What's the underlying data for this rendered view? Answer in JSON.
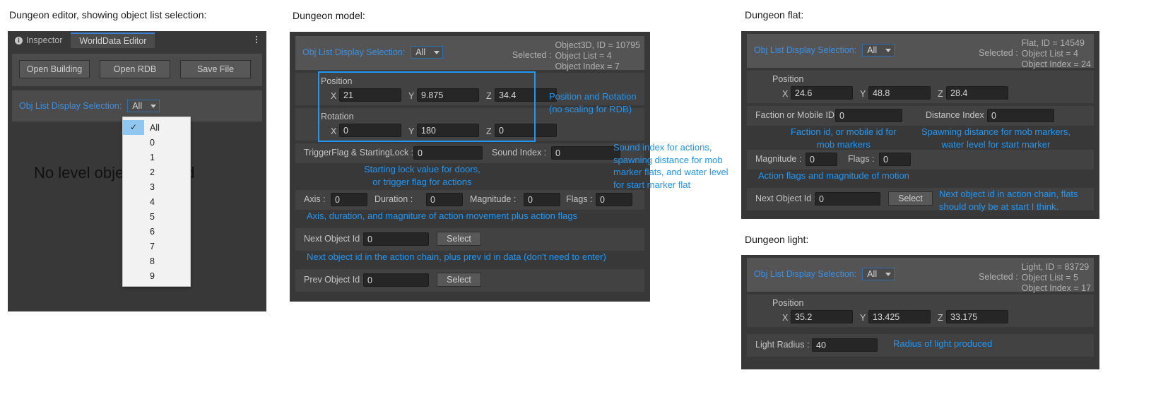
{
  "captions": {
    "editor": "Dungeon editor, showing object list selection:",
    "model": "Dungeon model:",
    "flat": "Dungeon flat:",
    "light": "Dungeon light:"
  },
  "editor_panel": {
    "tabs": [
      {
        "label": "Inspector",
        "icon": "info-icon",
        "active": false
      },
      {
        "label": "WorldData Editor",
        "icon": "",
        "active": true
      }
    ],
    "overflow_icon": "kebab-menu-icon",
    "buttons": [
      {
        "label": "Open Building"
      },
      {
        "label": "Open RDB"
      },
      {
        "label": "Save File"
      }
    ],
    "obj_list_label": "Obj List Display Selection:",
    "obj_list_value": "All",
    "empty_message": "No level objects loaded",
    "dropdown_options": [
      "All",
      "0",
      "1",
      "2",
      "3",
      "4",
      "5",
      "6",
      "7",
      "8",
      "9"
    ],
    "dropdown_selected": "All",
    "check_glyph": "✓"
  },
  "model_panel": {
    "obj_list_label": "Obj List Display Selection:",
    "obj_list_value": "All",
    "selected_label": "Selected :",
    "selected_lines": [
      "Object3D, ID = 10795",
      "Object List = 4",
      "Object Index = 7"
    ],
    "position_label": "Position",
    "position": {
      "x_label": "X",
      "x": "21",
      "y_label": "Y",
      "y": "9.875",
      "z_label": "Z",
      "z": "34.4"
    },
    "rotation_label": "Rotation",
    "rotation": {
      "x_label": "X",
      "x": "0",
      "y_label": "Y",
      "y": "180",
      "z_label": "Z",
      "z": "0"
    },
    "trigger_label": "TriggerFlag & StartingLock :",
    "trigger_value": "0",
    "sound_label": "Sound Index :",
    "sound_value": "0",
    "axis_label": "Axis :",
    "axis_value": "0",
    "duration_label": "Duration :",
    "duration_value": "0",
    "magnitude_label": "Magnitude :",
    "magnitude_value": "0",
    "flags_label": "Flags :",
    "flags_value": "0",
    "next_label": "Next Object Id :",
    "next_value": "0",
    "next_select": "Select",
    "prev_label": "Prev Object Id :",
    "prev_value": "0",
    "prev_select": "Select",
    "notes": {
      "pos_rot": "Position and Rotation\n(no scaling for RDB)",
      "sound": "Sound index for actions,\nspawning distance for mob\nmarker flats, and water level\nfor start marker flat",
      "trigger": "Starting lock value for doors,\nor trigger flag for actions",
      "axis": "Axis, duration, and magniture of action movement plus action flags",
      "next": "Next object id in the action chain, plus prev id in data (don't need to enter)"
    }
  },
  "flat_panel": {
    "obj_list_label": "Obj List Display Selection:",
    "obj_list_value": "All",
    "selected_label": "Selected :",
    "selected_lines": [
      "Flat, ID = 14549",
      "Object List = 4",
      "Object Index = 24"
    ],
    "position_label": "Position",
    "position": {
      "x_label": "X",
      "x": "24.6",
      "y_label": "Y",
      "y": "48.8",
      "z_label": "Z",
      "z": "28.4"
    },
    "faction_label": "Faction or Mobile ID :",
    "faction_value": "0",
    "distance_label": "Distance Index :",
    "distance_value": "0",
    "magnitude_label": "Magnitude :",
    "magnitude_value": "0",
    "flags_label": "Flags :",
    "flags_value": "0",
    "next_label": "Next Object Id :",
    "next_value": "0",
    "next_select": "Select",
    "notes": {
      "faction": "Faction id, or mobile id for\nmob markers",
      "distance": "Spawning distance for mob markers,\nwater level for start marker",
      "magnitude": "Action flags and magnitude of motion",
      "next": "Next object id in action chain, flats\nshould only be at start I think."
    }
  },
  "light_panel": {
    "obj_list_label": "Obj List Display Selection:",
    "obj_list_value": "All",
    "selected_label": "Selected :",
    "selected_lines": [
      "Light, ID = 83729",
      "Object List = 5",
      "Object Index = 17"
    ],
    "position_label": "Position",
    "position": {
      "x_label": "X",
      "x": "35.2",
      "y_label": "Y",
      "y": "13.425",
      "z_label": "Z",
      "z": "33.175"
    },
    "radius_label": "Light Radius :",
    "radius_value": "40",
    "notes": {
      "radius": "Radius of light produced"
    }
  },
  "colors": {
    "accent_blue": "#2196f3",
    "label_blue": "#3d8fe0",
    "panel_bg": "#383838",
    "group_bg": "#4b4b4b",
    "field_bg": "#262626"
  }
}
